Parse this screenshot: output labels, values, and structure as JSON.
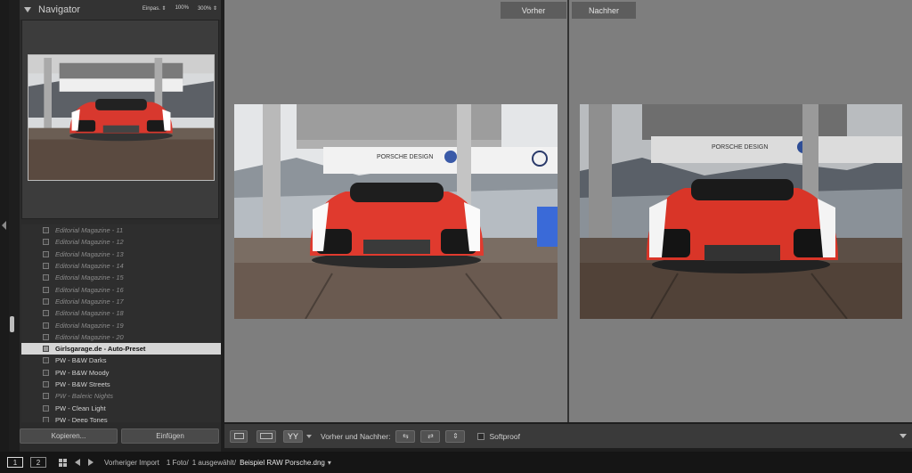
{
  "navigator": {
    "title": "Navigator",
    "zoom_options": [
      "Einpas. ⇕",
      "100%",
      "300% ⇕"
    ]
  },
  "presets": [
    {
      "label": "Editorial Magazine - 11",
      "dim": true
    },
    {
      "label": "Editorial Magazine - 12",
      "dim": true
    },
    {
      "label": "Editorial Magazine - 13",
      "dim": true
    },
    {
      "label": "Editorial Magazine - 14",
      "dim": true
    },
    {
      "label": "Editorial Magazine - 15",
      "dim": true
    },
    {
      "label": "Editorial Magazine - 16",
      "dim": true
    },
    {
      "label": "Editorial Magazine - 17",
      "dim": true
    },
    {
      "label": "Editorial Magazine - 18",
      "dim": true
    },
    {
      "label": "Editorial Magazine - 19",
      "dim": true
    },
    {
      "label": "Editorial Magazine - 20",
      "dim": true
    },
    {
      "label": "Girlsgarage.de  - Auto-Preset",
      "selected": true
    },
    {
      "label": "PW - B&W Darks"
    },
    {
      "label": "PW - B&W Moody"
    },
    {
      "label": "PW - B&W Streets"
    },
    {
      "label": "PW - Baleric Nights",
      "dim": true
    },
    {
      "label": "PW - Clean Light"
    },
    {
      "label": "PW - Deep Tones"
    }
  ],
  "buttons": {
    "copy": "Kopieren...",
    "paste": "Einfügen"
  },
  "compare": {
    "before_label": "Vorher",
    "after_label": "Nachher"
  },
  "toolbar": {
    "view_glyph": "YY",
    "before_after_label": "Vorher und Nachher:",
    "softproof_label": "Softproof"
  },
  "filmstrip": {
    "window1": "1",
    "window2": "2",
    "source": "Vorheriger Import",
    "count": "1 Foto/",
    "selected": "1 ausgewählt/",
    "filename": "Beispiel RAW Porsche.dng",
    "caret": "▾"
  }
}
